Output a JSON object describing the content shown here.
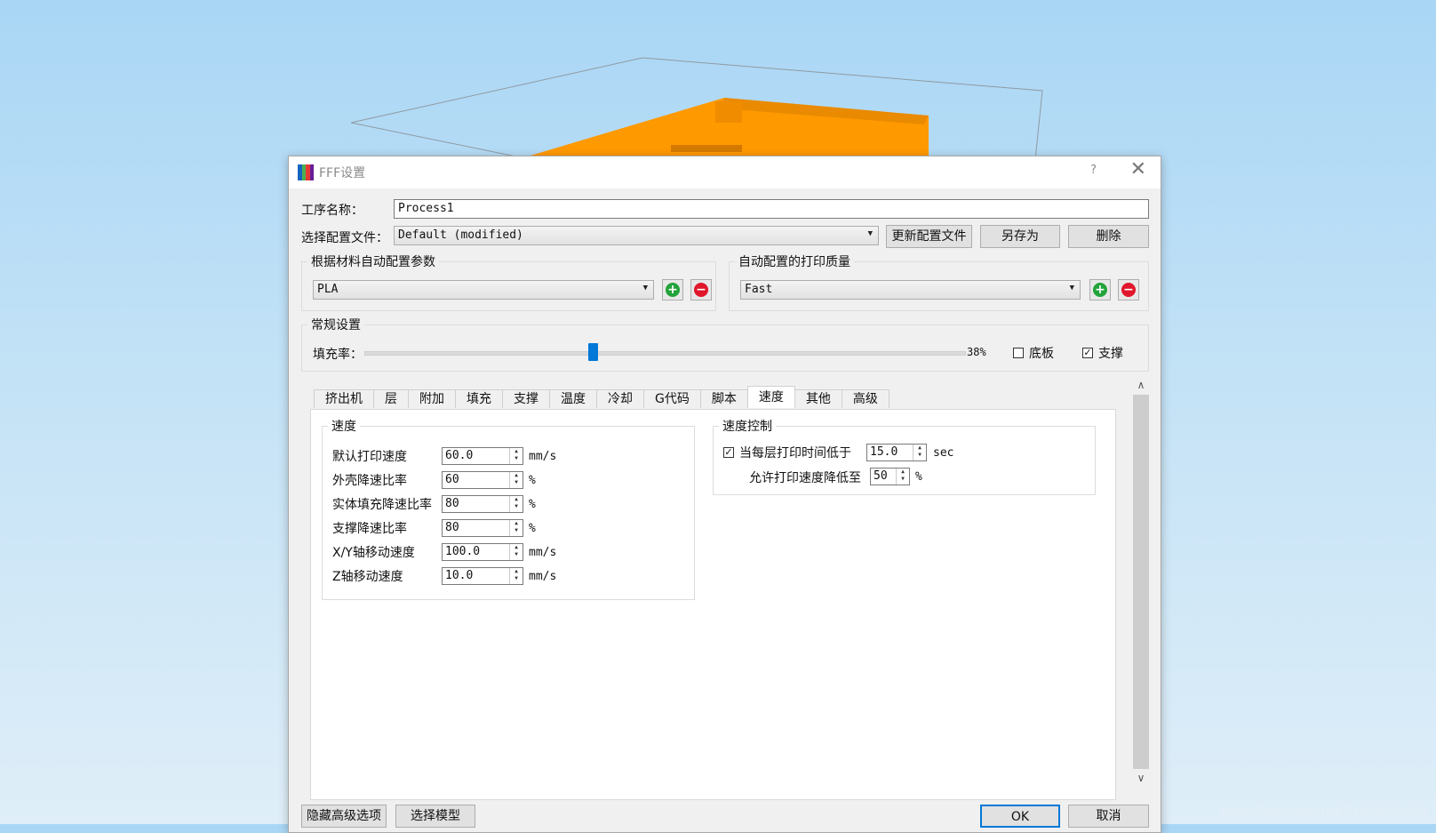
{
  "dialog": {
    "title": "FFF设置",
    "help_glyph": "?",
    "close_glyph": "✕",
    "process_name_label": "工序名称：",
    "process_name_value": "Process1",
    "profile_label": "选择配置文件：",
    "profile_value": "Default (modified)",
    "update_profile_button": "更新配置文件",
    "save_as_button": "另存为",
    "delete_button": "删除",
    "material_group_title": "根据材料自动配置参数",
    "material_value": "PLA",
    "quality_group_title": "自动配置的打印质量",
    "quality_value": "Fast",
    "general_group_title": "常规设置",
    "infill_label": "填充率：",
    "infill_percent_text": "38%",
    "infill_fraction": 0.38,
    "raft_label": "底板",
    "raft_checked": false,
    "support_label": "支撑",
    "support_checked": true,
    "hide_advanced_button": "隐藏高级选项",
    "select_model_button": "选择模型",
    "ok_button": "OK",
    "cancel_button": "取消"
  },
  "tabs": [
    {
      "label": "挤出机",
      "active": false
    },
    {
      "label": "层",
      "active": false
    },
    {
      "label": "附加",
      "active": false
    },
    {
      "label": "填充",
      "active": false
    },
    {
      "label": "支撑",
      "active": false
    },
    {
      "label": "温度",
      "active": false
    },
    {
      "label": "冷却",
      "active": false
    },
    {
      "label": "G代码",
      "active": false
    },
    {
      "label": "脚本",
      "active": false
    },
    {
      "label": "速度",
      "active": true
    },
    {
      "label": "其他",
      "active": false
    },
    {
      "label": "高级",
      "active": false
    }
  ],
  "speed": {
    "group_title": "速度",
    "rows": [
      {
        "label": "默认打印速度",
        "value": "60.0",
        "unit": "mm/s"
      },
      {
        "label": "外壳降速比率",
        "value": "60",
        "unit": "%"
      },
      {
        "label": "实体填充降速比率",
        "value": "80",
        "unit": "%"
      },
      {
        "label": "支撑降速比率",
        "value": "80",
        "unit": "%"
      },
      {
        "label": "X/Y轴移动速度",
        "value": "100.0",
        "unit": "mm/s"
      },
      {
        "label": "Z轴移动速度",
        "value": "10.0",
        "unit": "mm/s"
      }
    ]
  },
  "speed_control": {
    "group_title": "速度控制",
    "layer_time_label": "当每层打印时间低于",
    "layer_time_checked": true,
    "layer_time_value": "15.0",
    "layer_time_unit": "sec",
    "min_speed_label": "允许打印速度降低至",
    "min_speed_value": "50",
    "min_speed_unit": "%"
  },
  "watermark": "https://blog.csdn.net/C1664510416",
  "colors": {
    "accent": "#0078d7",
    "model_orange": "#ff9900",
    "add_green": "#22a33a",
    "remove_red": "#e0162b"
  }
}
